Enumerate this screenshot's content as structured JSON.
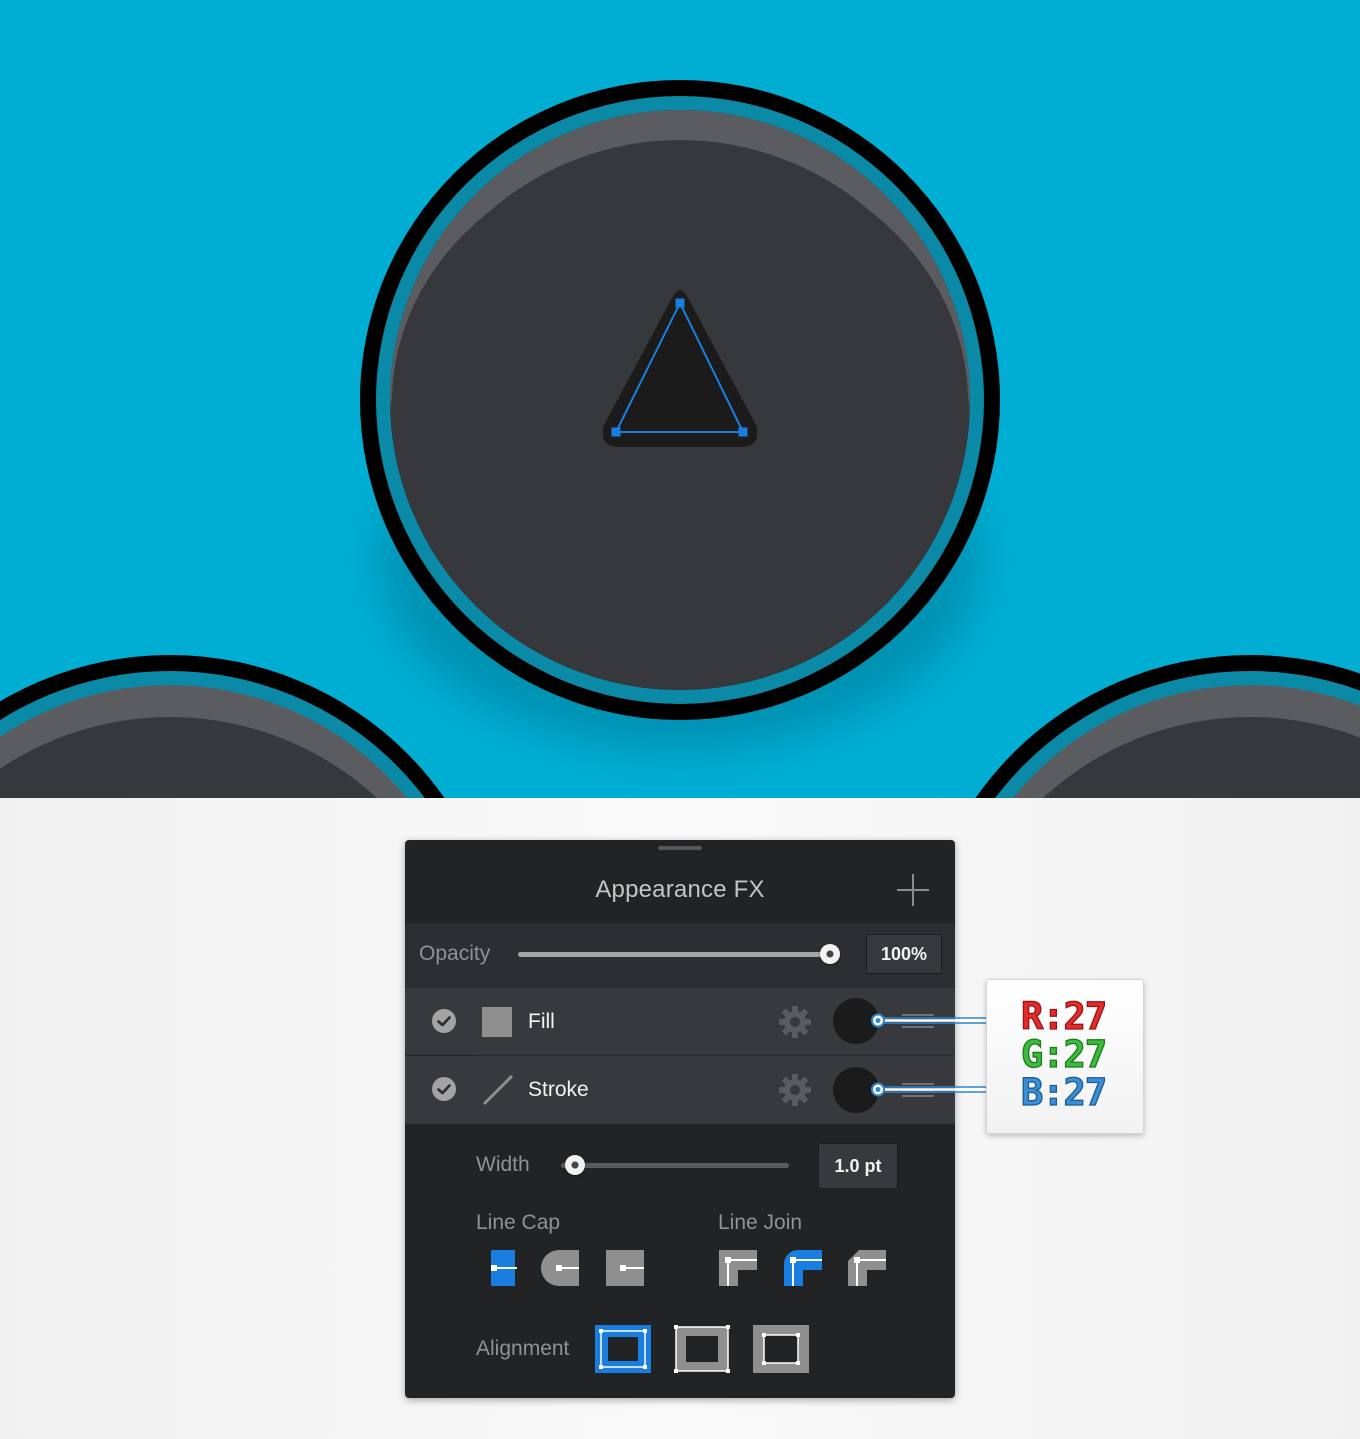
{
  "canvas": {
    "background_color": "#00aed4",
    "button_color": "#36383b",
    "button_top_color": "#5a5c60",
    "ring_color": "#0a8aa6",
    "outline_color": "#000000",
    "triangle_fill": "#1b1b1b",
    "selection_color": "#1a7de0"
  },
  "panel": {
    "title": "Appearance FX",
    "add_icon": "plus-icon",
    "opacity": {
      "label": "Opacity",
      "value_text": "100%",
      "value": 1.0
    },
    "appearance_items": [
      {
        "label": "Fill",
        "checked": true,
        "icon": "fill-square-icon",
        "settings_icon": "gear-icon",
        "color": "#1b1b1b",
        "menu_icon": "hamburger-icon"
      },
      {
        "label": "Stroke",
        "checked": true,
        "icon": "stroke-line-icon",
        "settings_icon": "gear-icon",
        "color": "#1b1b1b",
        "menu_icon": "hamburger-icon"
      }
    ],
    "stroke_options": {
      "width": {
        "label": "Width",
        "value_text": "1.0 pt",
        "value": 0.0
      },
      "line_cap": {
        "label": "Line Cap",
        "options": [
          "butt-cap-icon",
          "round-cap-icon",
          "projecting-cap-icon"
        ],
        "selected": 0
      },
      "line_join": {
        "label": "Line Join",
        "options": [
          "miter-join-icon",
          "round-join-icon",
          "bevel-join-icon"
        ],
        "selected": 1
      },
      "alignment": {
        "label": "Alignment",
        "options": [
          "align-inside-icon",
          "align-center-icon",
          "align-outside-icon"
        ],
        "selected": 0
      }
    },
    "accent_color": "#1a7de0"
  },
  "rgb_callout": {
    "r": "R:27",
    "g": "G:27",
    "b": "B:27"
  }
}
